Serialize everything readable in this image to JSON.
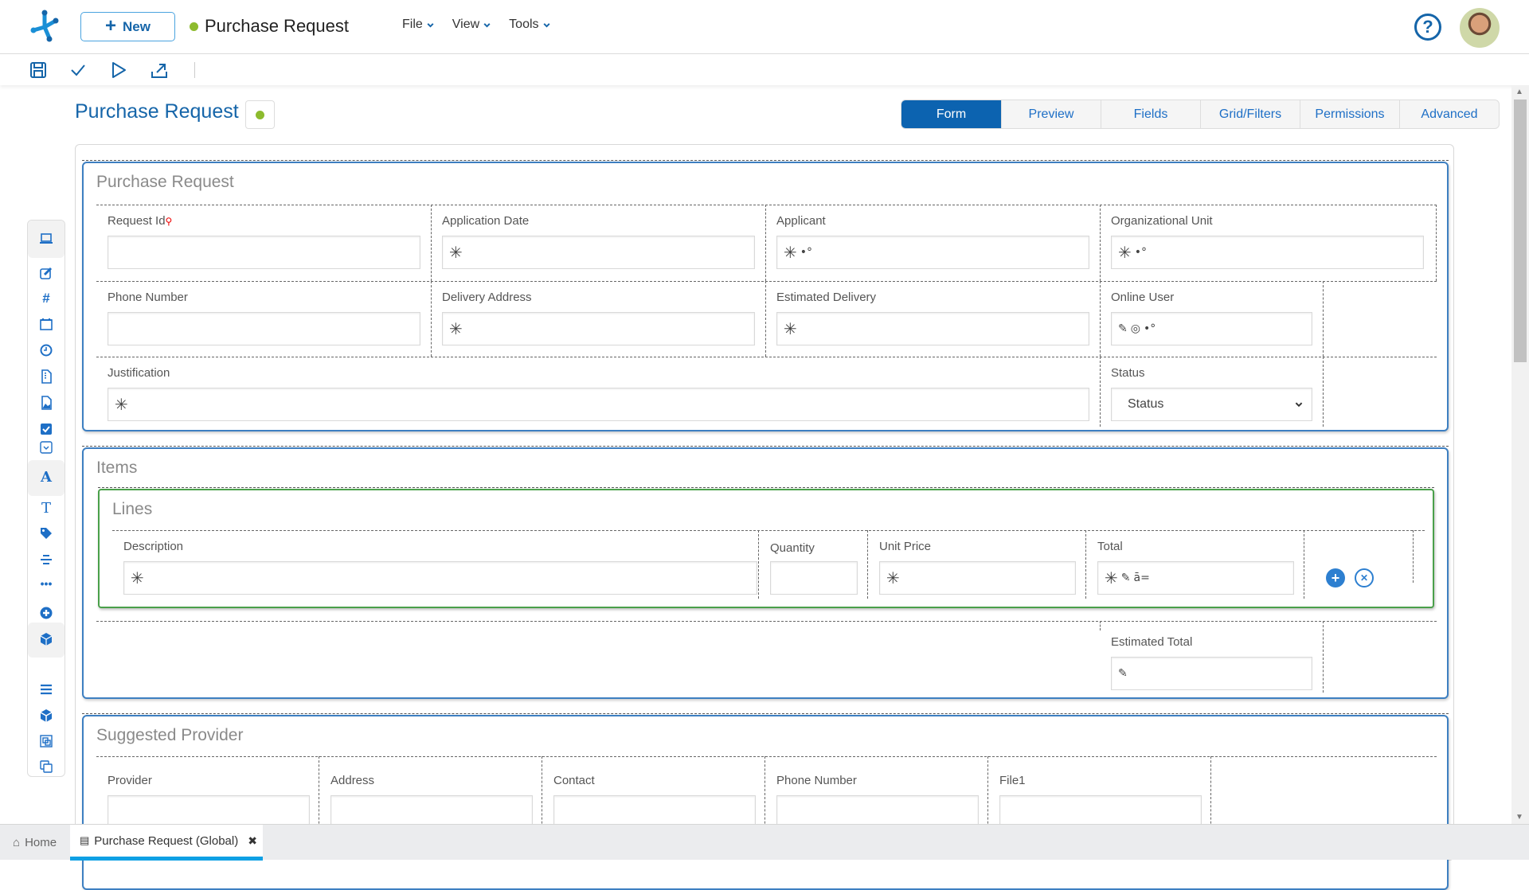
{
  "header": {
    "new_label": "New",
    "app_title": "Purchase Request",
    "status_color": "#8dbb2e",
    "menus": [
      {
        "label": "File"
      },
      {
        "label": "View"
      },
      {
        "label": "Tools"
      }
    ],
    "help_glyph": "?"
  },
  "toolbar": {
    "icons": [
      "save-icon",
      "check-icon",
      "play-icon",
      "export-icon"
    ]
  },
  "page": {
    "title": "Purchase Request",
    "tabs": [
      {
        "label": "Form",
        "active": true
      },
      {
        "label": "Preview"
      },
      {
        "label": "Fields"
      },
      {
        "label": "Grid/Filters"
      },
      {
        "label": "Permissions"
      },
      {
        "label": "Advanced"
      }
    ]
  },
  "palette": {
    "icons": [
      "laptop-icon",
      "edit-icon",
      "hash-icon",
      "calendar-icon",
      "clock-icon",
      "file-zip-icon",
      "image-file-icon",
      "checkbox-icon",
      "dropdown-icon",
      "font-icon",
      "text-icon",
      "tags-icon",
      "align-icon",
      "ellipsis-icon",
      "plus-circle-icon",
      "cube-icon",
      "list-icon",
      "cube-outline-icon",
      "group-icon",
      "copy-icon"
    ]
  },
  "sections": {
    "purchase_request": {
      "title": "Purchase Request",
      "fields": {
        "request_id": "Request Id",
        "application_date": "Application Date",
        "applicant": "Applicant",
        "org_unit": "Organizational Unit",
        "phone": "Phone Number",
        "delivery_address": "Delivery Address",
        "estimated_delivery": "Estimated Delivery",
        "online_user": "Online User",
        "justification": "Justification",
        "status": "Status",
        "status_selected": "Status"
      }
    },
    "items": {
      "title": "Items",
      "lines": {
        "title": "Lines",
        "columns": {
          "description": "Description",
          "quantity": "Quantity",
          "unit_price": "Unit Price",
          "total": "Total"
        }
      },
      "estimated_total": "Estimated Total"
    },
    "provider": {
      "title": "Suggested Provider",
      "fields": {
        "provider": "Provider",
        "address": "Address",
        "contact": "Contact",
        "phone": "Phone Number",
        "file": "File1"
      }
    }
  },
  "glyphs": {
    "required": "✳",
    "key": "🔑",
    "lookup": "•°",
    "readonly": "✎",
    "hidden": "◎",
    "formula": "ā="
  },
  "bottom_tabs": [
    {
      "label": "Home"
    },
    {
      "label": "Purchase Request (Global)",
      "active": true,
      "close": "✖"
    }
  ]
}
